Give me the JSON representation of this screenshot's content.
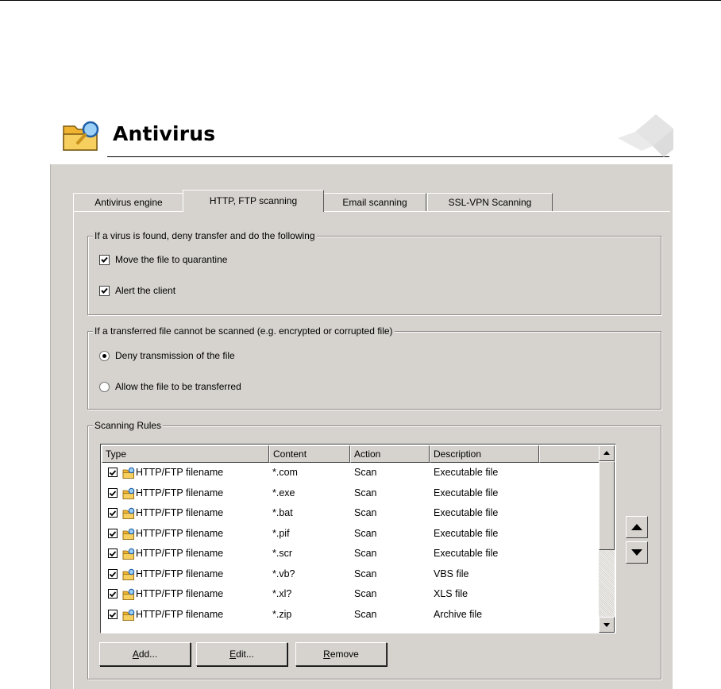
{
  "header": {
    "title": "Antivirus"
  },
  "tabs": [
    {
      "label": "Antivirus engine",
      "active": false
    },
    {
      "label": "HTTP, FTP scanning",
      "active": true
    },
    {
      "label": "Email scanning",
      "active": false
    },
    {
      "label": "SSL-VPN Scanning",
      "active": false
    }
  ],
  "virus_found_group": {
    "legend": "If a virus is found, deny transfer and do the following",
    "options": [
      {
        "label": "Move the file to quarantine",
        "checked": true
      },
      {
        "label": "Alert the client",
        "checked": true
      }
    ]
  },
  "unscannable_group": {
    "legend": "If a transferred file cannot be scanned (e.g. encrypted or corrupted file)",
    "options": [
      {
        "label": "Deny transmission of the file",
        "selected": true
      },
      {
        "label": "Allow the file to be transferred",
        "selected": false
      }
    ]
  },
  "scanning_rules": {
    "legend": "Scanning Rules",
    "columns": [
      "Type",
      "Content",
      "Action",
      "Description"
    ],
    "rows": [
      {
        "checked": true,
        "type": "HTTP/FTP filename",
        "content": "*.com",
        "action": "Scan",
        "description": "Executable file"
      },
      {
        "checked": true,
        "type": "HTTP/FTP filename",
        "content": "*.exe",
        "action": "Scan",
        "description": "Executable file"
      },
      {
        "checked": true,
        "type": "HTTP/FTP filename",
        "content": "*.bat",
        "action": "Scan",
        "description": "Executable file"
      },
      {
        "checked": true,
        "type": "HTTP/FTP filename",
        "content": "*.pif",
        "action": "Scan",
        "description": "Executable file"
      },
      {
        "checked": true,
        "type": "HTTP/FTP filename",
        "content": "*.scr",
        "action": "Scan",
        "description": "Executable file"
      },
      {
        "checked": true,
        "type": "HTTP/FTP filename",
        "content": "*.vb?",
        "action": "Scan",
        "description": "VBS file"
      },
      {
        "checked": true,
        "type": "HTTP/FTP filename",
        "content": "*.xl?",
        "action": "Scan",
        "description": "XLS file"
      },
      {
        "checked": true,
        "type": "HTTP/FTP filename",
        "content": "*.zip",
        "action": "Scan",
        "description": "Archive file"
      }
    ],
    "buttons": {
      "add": {
        "mnemonic": "A",
        "rest": "dd..."
      },
      "edit": {
        "mnemonic": "E",
        "rest": "dit..."
      },
      "remove": {
        "mnemonic": "R",
        "rest": "emove"
      }
    }
  },
  "icons": {
    "header": "folder-search-icon",
    "row": "folder-search-icon",
    "up": "arrow-up-icon",
    "down": "arrow-down-icon"
  },
  "colors": {
    "panel": "#d6d3ce",
    "folder": "#f0b431",
    "lens": "#3c8dde"
  }
}
